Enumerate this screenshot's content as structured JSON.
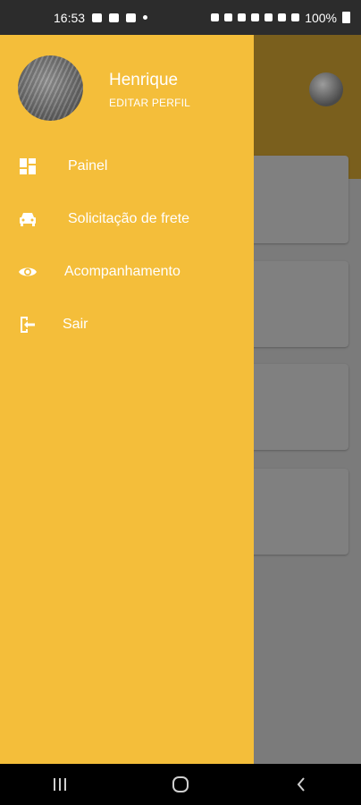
{
  "status_bar": {
    "time": "16:53",
    "battery": "100%"
  },
  "drawer": {
    "profile": {
      "name": "Henrique",
      "edit_label": "EDITAR PERFIL"
    },
    "menu": [
      {
        "label": "Painel",
        "icon": "dashboard-icon"
      },
      {
        "label": "Solicitação de frete",
        "icon": "car-icon"
      },
      {
        "label": "Acompanhamento",
        "icon": "eye-icon"
      },
      {
        "label": "Sair",
        "icon": "logout-icon"
      }
    ]
  },
  "colors": {
    "drawer_bg": "#f4be3a",
    "scrim": "#7b7b7b",
    "header_dimmed": "#7a5f1d"
  },
  "navigation_bar": {
    "buttons": [
      "recents-icon",
      "home-icon",
      "back-icon"
    ]
  }
}
